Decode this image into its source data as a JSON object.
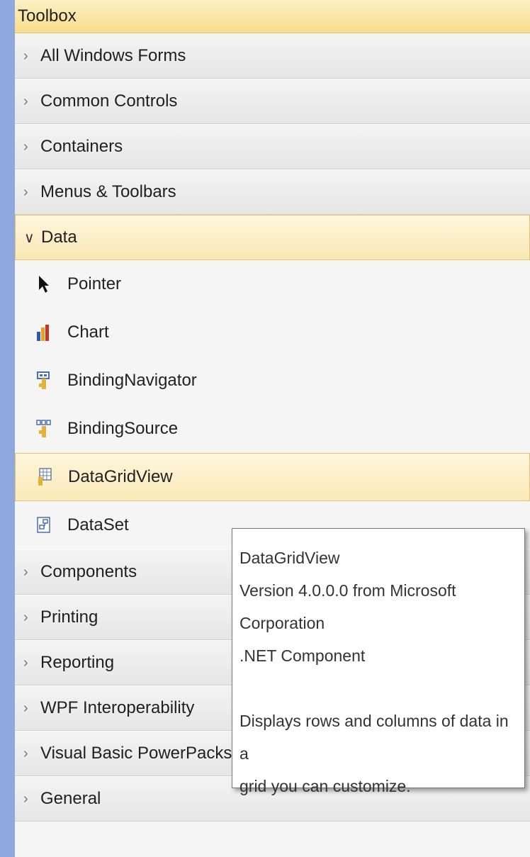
{
  "toolbox": {
    "title": "Toolbox",
    "groups_before": [
      {
        "label": "All Windows Forms"
      },
      {
        "label": "Common Controls"
      },
      {
        "label": "Containers"
      },
      {
        "label": "Menus & Toolbars"
      }
    ],
    "expanded_group": {
      "label": "Data",
      "items": [
        {
          "label": "Pointer",
          "icon": "pointer-icon"
        },
        {
          "label": "Chart",
          "icon": "chart-icon"
        },
        {
          "label": "BindingNavigator",
          "icon": "binding-navigator-icon"
        },
        {
          "label": "BindingSource",
          "icon": "binding-source-icon"
        },
        {
          "label": "DataGridView",
          "icon": "datagridview-icon",
          "selected": true
        },
        {
          "label": "DataSet",
          "icon": "dataset-icon"
        }
      ]
    },
    "groups_after": [
      {
        "label": "Components"
      },
      {
        "label": "Printing"
      },
      {
        "label": "Reporting"
      },
      {
        "label": "WPF Interoperability"
      },
      {
        "label": "Visual Basic PowerPacks"
      },
      {
        "label": "General"
      }
    ]
  },
  "tooltip": {
    "name": "DataGridView",
    "version": "Version 4.0.0.0 from Microsoft Corporation",
    "component": ".NET Component",
    "desc_line1": "Displays rows and columns of data in a",
    "desc_line2": "grid you can customize."
  },
  "colors": {
    "accent": "#f8dc8a",
    "selected_bg": "#fbe9b9",
    "background": "#8fa8dd"
  }
}
